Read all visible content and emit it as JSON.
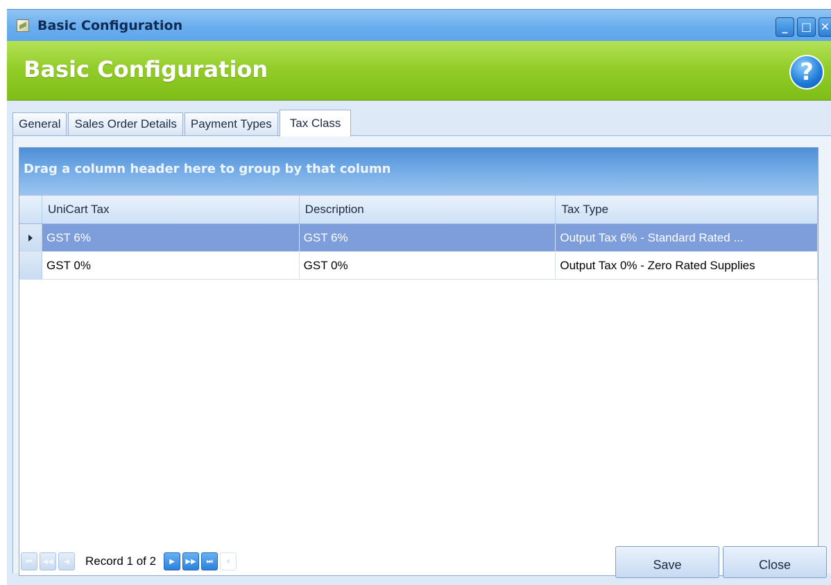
{
  "window": {
    "title": "Basic Configuration",
    "buttons": {
      "minimize": "_",
      "maximize": "□",
      "close": "✕"
    }
  },
  "header": {
    "title": "Basic Configuration",
    "help_glyph": "?"
  },
  "tabs": [
    {
      "label": "General"
    },
    {
      "label": "Sales Order Details"
    },
    {
      "label": "Payment Types"
    },
    {
      "label": "Tax Class",
      "active": true
    }
  ],
  "grid": {
    "group_panel_text": "Drag a column header here to group by that column",
    "columns": [
      "UniCart Tax",
      "Description",
      "Tax Type"
    ],
    "rows": [
      {
        "unicart_tax": "GST 6%",
        "description": "GST 6%",
        "tax_type": "Output Tax 6% - Standard Rated ...",
        "selected": true
      },
      {
        "unicart_tax": "GST 0%",
        "description": "GST 0%",
        "tax_type": "Output Tax 0% - Zero Rated Supplies",
        "selected": false
      }
    ]
  },
  "navigator": {
    "record_text": "Record 1 of 2"
  },
  "actions": {
    "save_label": "Save",
    "close_label": "Close"
  },
  "colors": {
    "titlebar": "#6aaeee",
    "header_green": "#94cd2a",
    "selected_row": "#7d9ddb",
    "group_panel": "#6ea7e5"
  }
}
